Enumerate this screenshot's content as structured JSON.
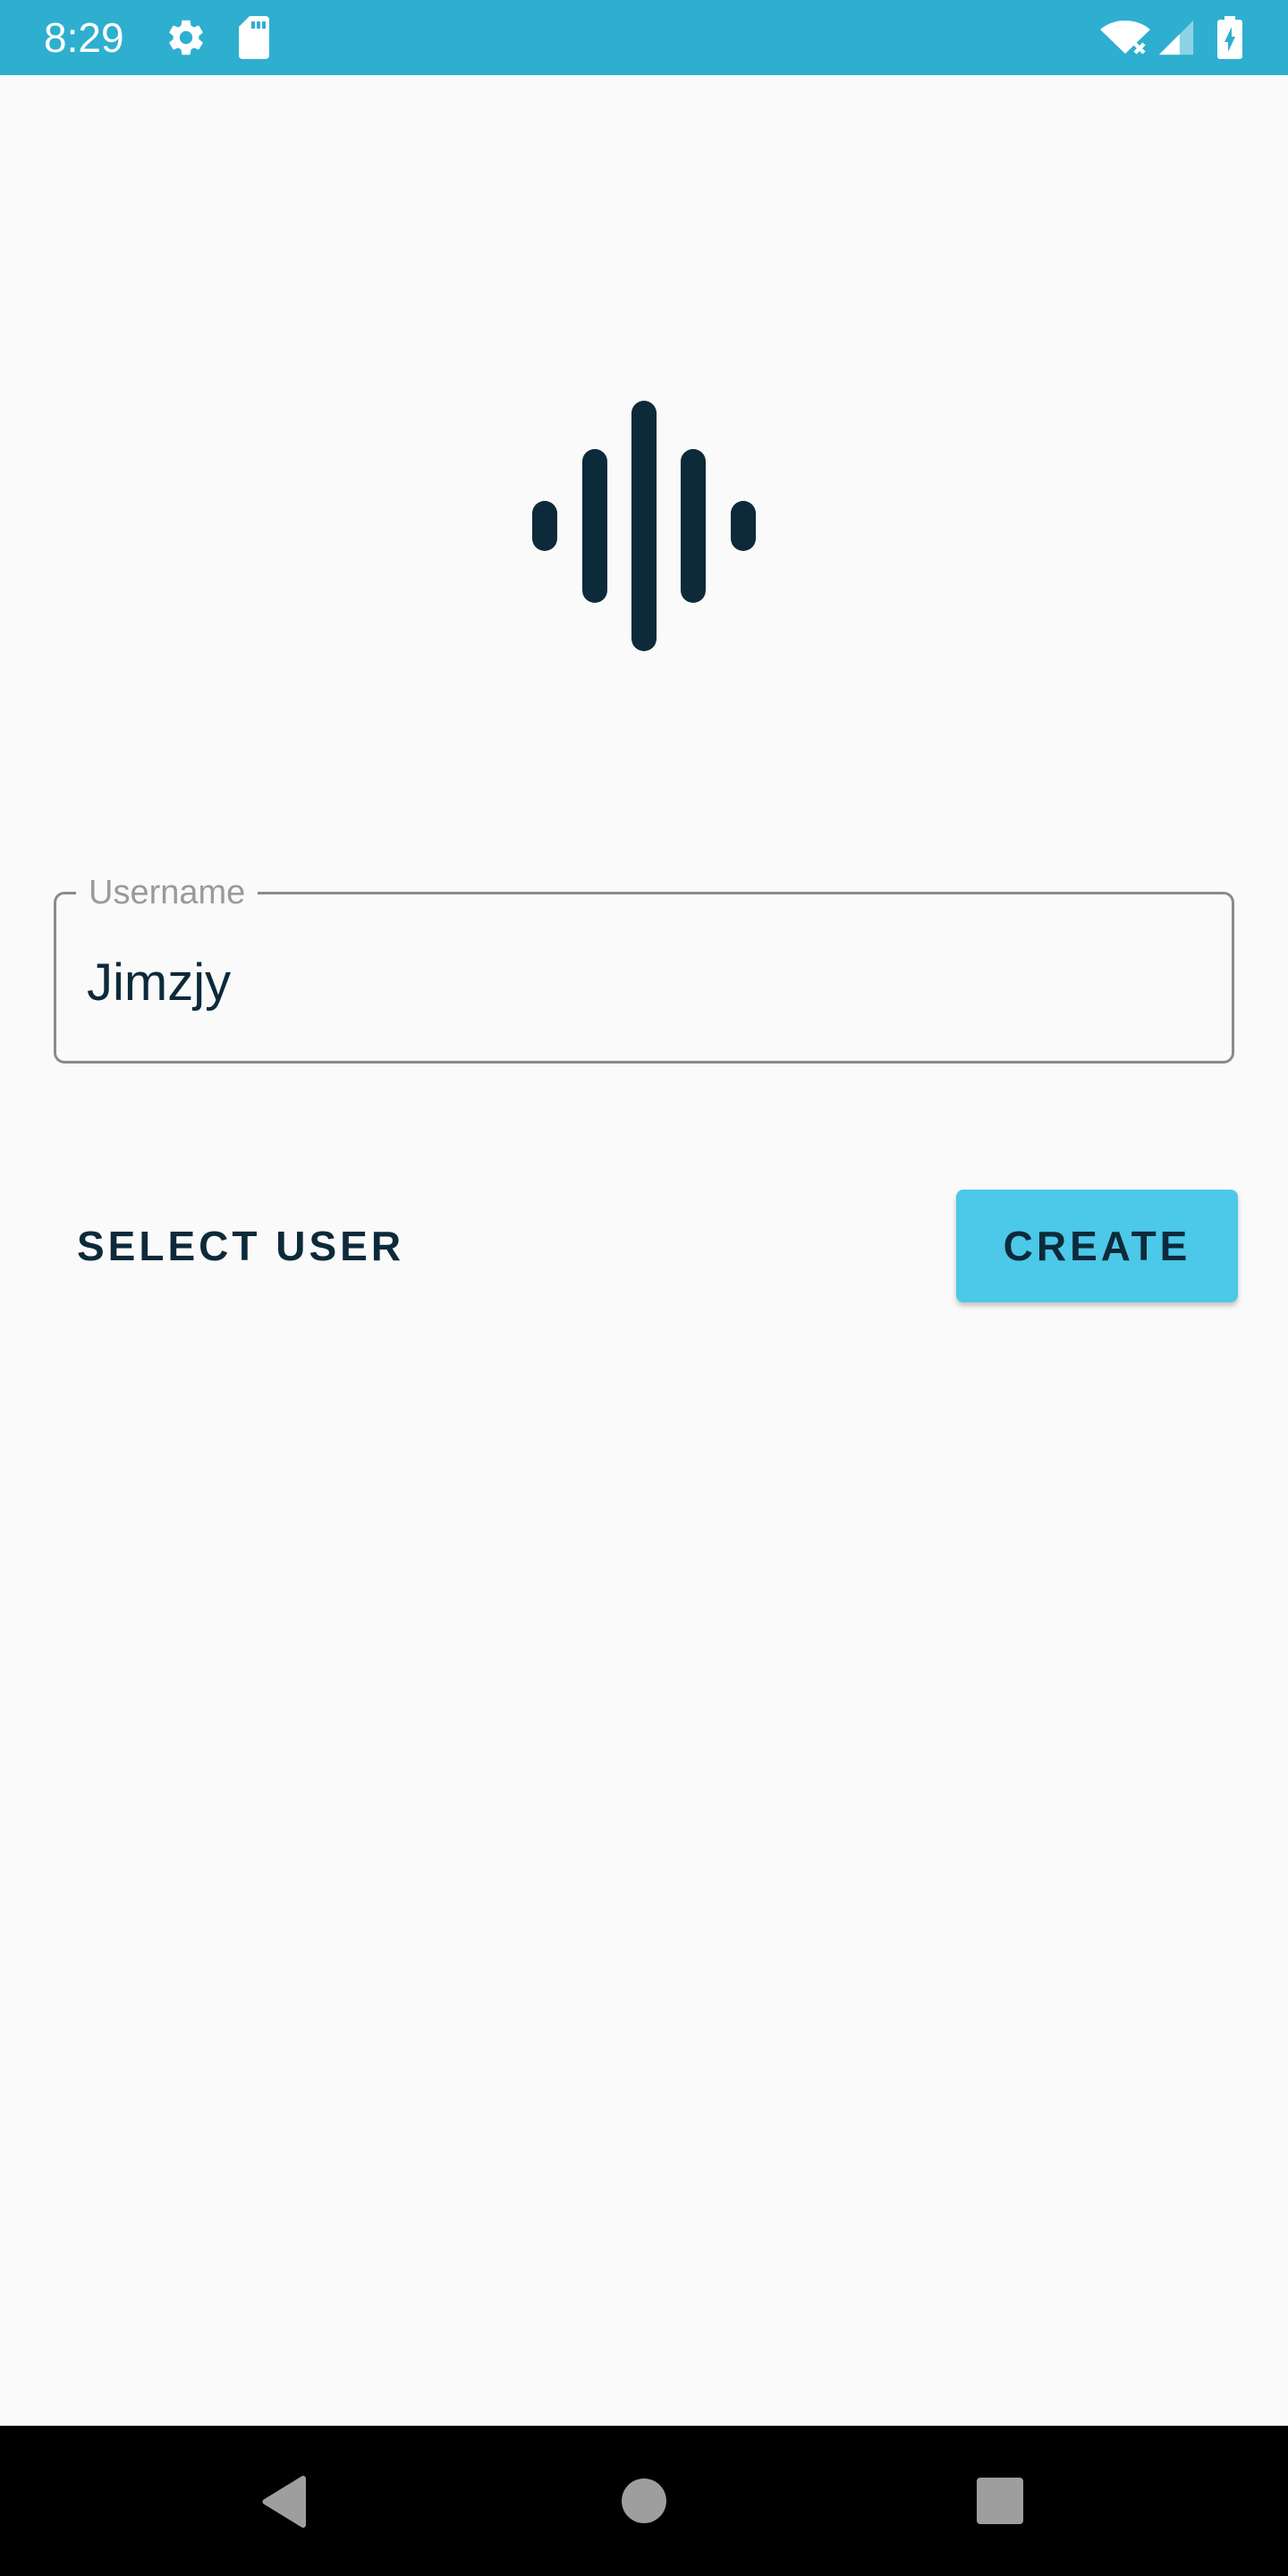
{
  "status_bar": {
    "time": "8:29",
    "background_color": "#2EAFD0",
    "left_icons": [
      "gear-icon",
      "sd-card-icon"
    ],
    "right_icons": [
      "wifi-icon",
      "cell-signal-icon",
      "battery-charging-icon"
    ]
  },
  "logo": {
    "icon": "sound-wave-icon",
    "color": "#0D2A3A"
  },
  "username_field": {
    "label": "Username",
    "value": "Jimzjy"
  },
  "actions": {
    "select_user_label": "SELECT USER",
    "create_label": "CREATE",
    "create_color": "#4CC8E8"
  },
  "nav_bar": {
    "icons": [
      "back-icon",
      "home-icon",
      "recents-icon"
    ]
  }
}
